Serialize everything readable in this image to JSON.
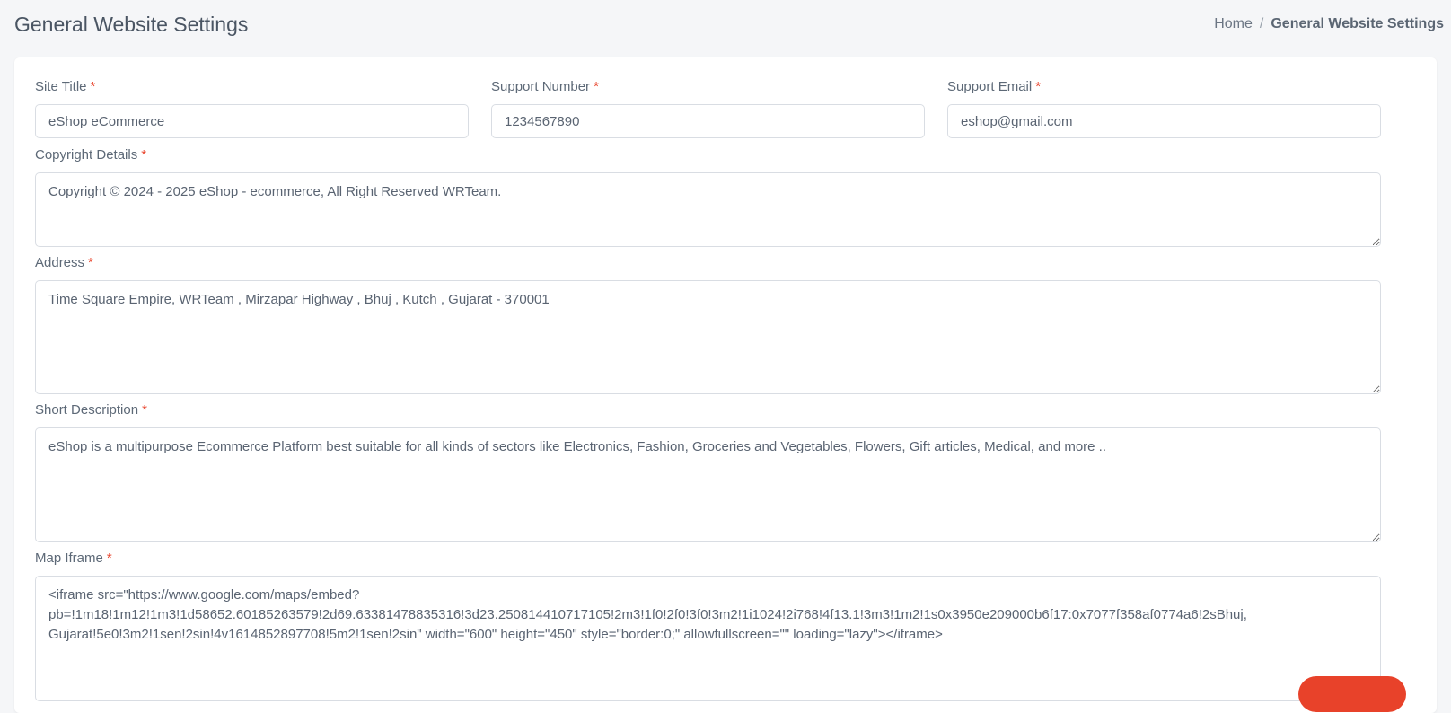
{
  "header": {
    "title": "General Website Settings",
    "breadcrumb": {
      "home": "Home",
      "separator": "/",
      "current": "General Website Settings"
    }
  },
  "form": {
    "required_marker": "*",
    "site_title": {
      "label": "Site Title",
      "value": "eShop eCommerce"
    },
    "support_number": {
      "label": "Support Number",
      "value": "1234567890"
    },
    "support_email": {
      "label": "Support Email",
      "value": "eshop@gmail.com"
    },
    "copyright": {
      "label": "Copyright Details",
      "value": "Copyright © 2024 - 2025 eShop - ecommerce, All Right Reserved WRTeam."
    },
    "address": {
      "label": "Address",
      "value": "Time Square Empire, WRTeam , Mirzapar Highway , Bhuj , Kutch , Gujarat - 370001"
    },
    "short_description": {
      "label": "Short Description",
      "value": "eShop is a multipurpose Ecommerce Platform best suitable for all kinds of sectors like Electronics, Fashion, Groceries and Vegetables, Flowers, Gift articles, Medical, and more .."
    },
    "map_iframe": {
      "label": "Map Iframe",
      "value": "<iframe src=\"https://www.google.com/maps/embed?pb=!1m18!1m12!1m3!1d58652.60185263579!2d69.63381478835316!3d23.250814410717105!2m3!1f0!2f0!3f0!3m2!1i1024!2i768!4f13.1!3m3!1m2!1s0x3950e209000b6f17:0x7077f358af0774a6!2sBhuj, Gujarat!5e0!3m2!1sen!2sin!4v1614852897708!5m2!1sen!2sin\" width=\"600\" height=\"450\" style=\"border:0;\" allowfullscreen=\"\" loading=\"lazy\"></iframe>"
    }
  },
  "colors": {
    "accent": "#e8422a",
    "background": "#f5f6f8",
    "card": "#ffffff"
  }
}
